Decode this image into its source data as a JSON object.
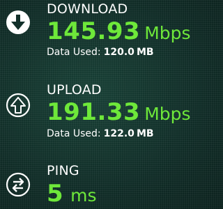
{
  "download": {
    "label": "DOWNLOAD",
    "value": "145.93",
    "unit": "Mbps",
    "used_label": "Data Used:",
    "used_value": "120.0",
    "used_unit": "MB",
    "icon": "download-arrow-icon"
  },
  "upload": {
    "label": "UPLOAD",
    "value": "191.33",
    "unit": "Mbps",
    "used_label": "Data Used:",
    "used_value": "122.0",
    "used_unit": "MB",
    "icon": "upload-arrow-icon"
  },
  "ping": {
    "label": "PING",
    "value": "5",
    "unit": "ms",
    "icon": "ping-arrows-icon"
  },
  "colors": {
    "background": "#12302a",
    "accent": "#6ee83a",
    "text": "#ffffff"
  }
}
